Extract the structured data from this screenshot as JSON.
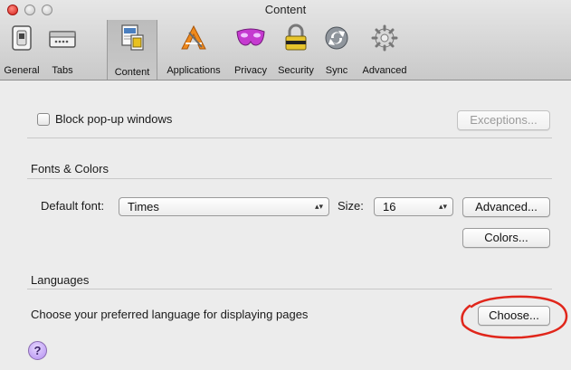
{
  "window": {
    "title": "Content"
  },
  "toolbar": {
    "items": [
      {
        "label": "General",
        "icon": "general-switch-icon"
      },
      {
        "label": "Tabs",
        "icon": "tabs-icon"
      },
      {
        "label": "Content",
        "icon": "content-page-icon",
        "selected": true
      },
      {
        "label": "Applications",
        "icon": "applications-icon"
      },
      {
        "label": "Privacy",
        "icon": "privacy-mask-icon"
      },
      {
        "label": "Security",
        "icon": "security-lock-icon"
      },
      {
        "label": "Sync",
        "icon": "sync-icon"
      },
      {
        "label": "Advanced",
        "icon": "advanced-gear-icon"
      }
    ]
  },
  "content": {
    "block_popups": {
      "label": "Block pop-up windows",
      "checked": false
    },
    "exceptions_label": "Exceptions...",
    "fonts_section": {
      "heading": "Fonts & Colors",
      "default_font_label": "Default font:",
      "default_font_value": "Times",
      "size_label": "Size:",
      "size_value": "16",
      "advanced_label": "Advanced...",
      "colors_label": "Colors..."
    },
    "languages_section": {
      "heading": "Languages",
      "description": "Choose your preferred language for displaying pages",
      "choose_label": "Choose..."
    },
    "help_label": "?"
  },
  "colors": {
    "annotation_ring": "#e0261b",
    "close_button": "#d4201a",
    "help_button": "#b38ef0"
  }
}
